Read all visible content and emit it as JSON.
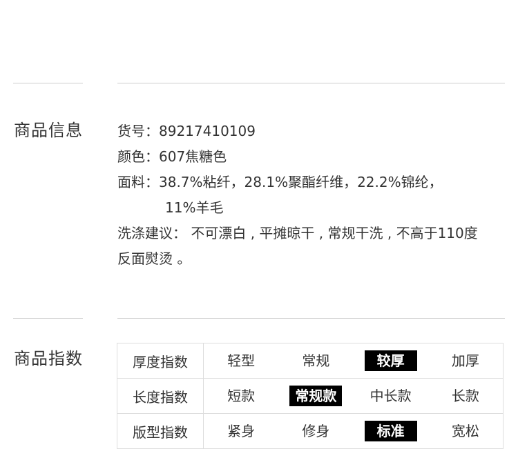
{
  "product_info": {
    "title": "商品信息",
    "item_no": {
      "label": "货号：",
      "value": "89217410109"
    },
    "color": {
      "label": "颜色：",
      "value": "607焦糖色"
    },
    "fabric": {
      "label": "面料：",
      "value_line1": "38.7%粘纤，28.1%聚酯纤维，22.2%锦纶，",
      "value_line2": "11%羊毛"
    },
    "care": {
      "label": "洗涤建议：",
      "value": "不可漂白 , 平摊晾干 , 常规干洗 , 不高于110度反面熨烫 。"
    }
  },
  "product_index": {
    "title": "商品指数",
    "rows": [
      {
        "label": "厚度指数",
        "options": [
          "轻型",
          "常规",
          "较厚",
          "加厚"
        ],
        "selected": 2
      },
      {
        "label": "长度指数",
        "options": [
          "短款",
          "常规款",
          "中长款",
          "长款"
        ],
        "selected": 1
      },
      {
        "label": "版型指数",
        "options": [
          "紧身",
          "修身",
          "标准",
          "宽松"
        ],
        "selected": 2
      }
    ]
  },
  "colors": {
    "rule": "#cccccc",
    "cell_border": "#dddddd",
    "selected_bg": "#000000",
    "selected_text": "#ffffff",
    "text": "#333333"
  }
}
